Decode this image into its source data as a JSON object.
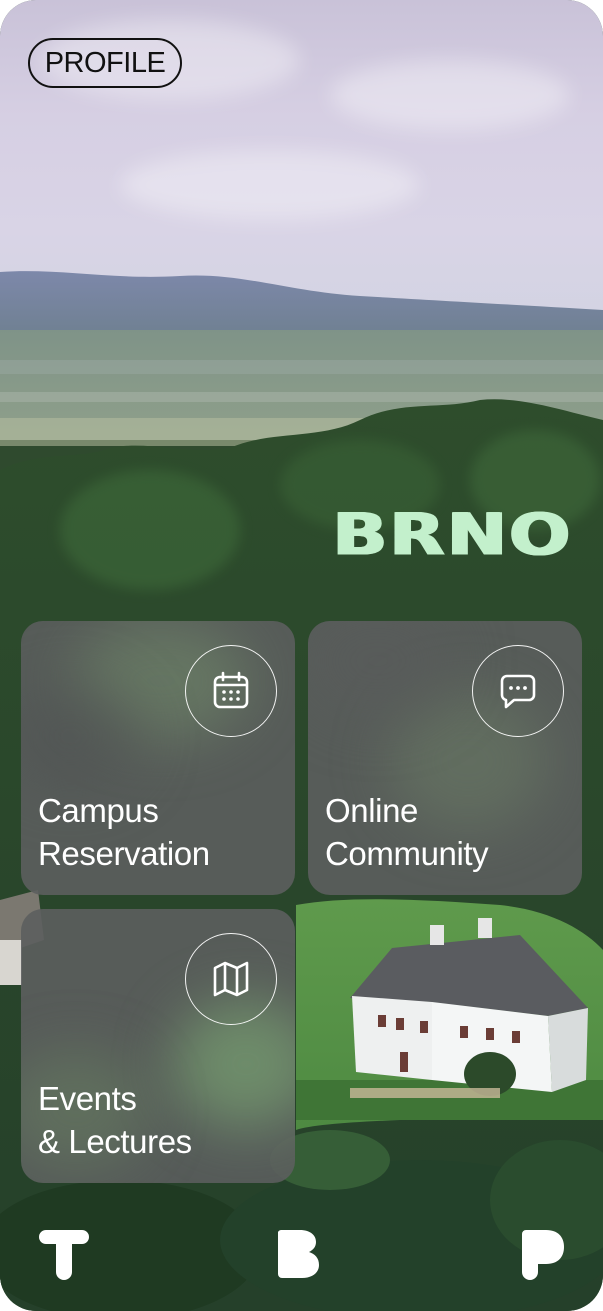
{
  "header": {
    "profile_label": "PROFILE"
  },
  "brand": {
    "wordmark": "BRNO",
    "color": "#c3f0cc"
  },
  "cards": [
    {
      "line1": "Campus",
      "line2": "Reservation",
      "icon": "calendar-icon"
    },
    {
      "line1": "Online",
      "line2": "Community",
      "icon": "chat-bubble-icon"
    },
    {
      "line1": "Events",
      "line2": "& Lectures",
      "icon": "map-icon"
    }
  ],
  "bottom_nav": [
    {
      "icon": "letter-t-icon"
    },
    {
      "icon": "letter-b-icon"
    },
    {
      "icon": "letter-p-icon"
    }
  ],
  "colors": {
    "card_background": "#5c5e5e",
    "text": "#ffffff",
    "outline": "#111111"
  }
}
